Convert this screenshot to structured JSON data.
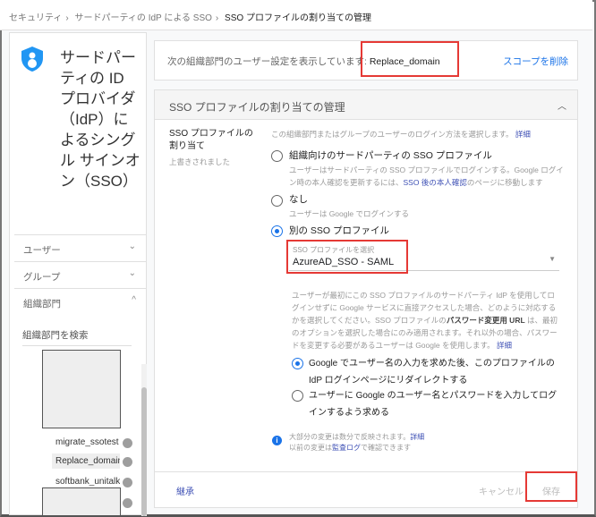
{
  "breadcrumb": [
    "セキュリティ",
    "サードパーティの IdP による SSO",
    "SSO プロファイルの割り当ての管理"
  ],
  "sidebar": {
    "title": "サードパーティの ID プロバイダ（IdP）によるシングル サインオン（SSO）",
    "nav": [
      {
        "label": "ユーザー",
        "chevron": "⌄"
      },
      {
        "label": "グループ",
        "chevron": "⌄"
      },
      {
        "label": "組織部門",
        "chevron": "^"
      }
    ],
    "search_placeholder": "組織部門を検索",
    "org_units": [
      "migrate_ssotest",
      "Replace_domain",
      "softbank_unitalk"
    ]
  },
  "scope": {
    "text": "次の組織部門のユーザー設定を表示しています:",
    "domain": "Replace_domain",
    "remove": "スコープを削除"
  },
  "section": {
    "title": "SSO プロファイルの割り当ての管理",
    "field_label": "SSO プロファイルの割り当て",
    "overridden": "上書きされました",
    "description": "この組織部門またはグループのユーザーのログイン方法を選択します。",
    "details": "詳細",
    "options": [
      {
        "label": "組織向けのサードパーティの SSO プロファイル",
        "help1": "ユーザーはサードパーティの SSO プロファイルでログインする。Google ログイン時の本人確認を更新するには、",
        "help_link": "SSO 後の本人確認",
        "help2": "のページに移動します",
        "selected": false
      },
      {
        "label": "なし",
        "help1": "ユーザーは Google でログインする",
        "selected": false
      },
      {
        "label": "別の SSO プロファイル",
        "selected": true
      }
    ],
    "select_label": "SSO プロファイルを選択",
    "select_value": "AzureAD_SSO - SAML",
    "para1": "ユーザーが最初にこの SSO プロファイルのサードパーティ IdP を使用してログインせずに Google サービスに直接アクセスした場合、どのように対応するかを選択してください。SSO プロファイルの",
    "para_bold": "パスワード変更用 URL",
    "para2": "は、最初のオプションを選択した場合にのみ適用されます。それ以外の場合、パスワードを変更する必要があるユーザーは Google を使用します。",
    "sub_options": [
      {
        "label": "Google でユーザー名の入力を求めた後、このプロファイルの IdP ログインページにリダイレクトする",
        "selected": true
      },
      {
        "label": "ユーザーに Google のユーザー名とパスワードを入力してログインするよう求める",
        "selected": false
      }
    ],
    "info1": "大部分の変更は数分で反映されます。",
    "info2": "以前の変更は",
    "audit_log": "監査ログ",
    "info3": "で確認できます"
  },
  "footer": {
    "inherit": "継承",
    "cancel": "キャンセル",
    "save": "保存"
  }
}
